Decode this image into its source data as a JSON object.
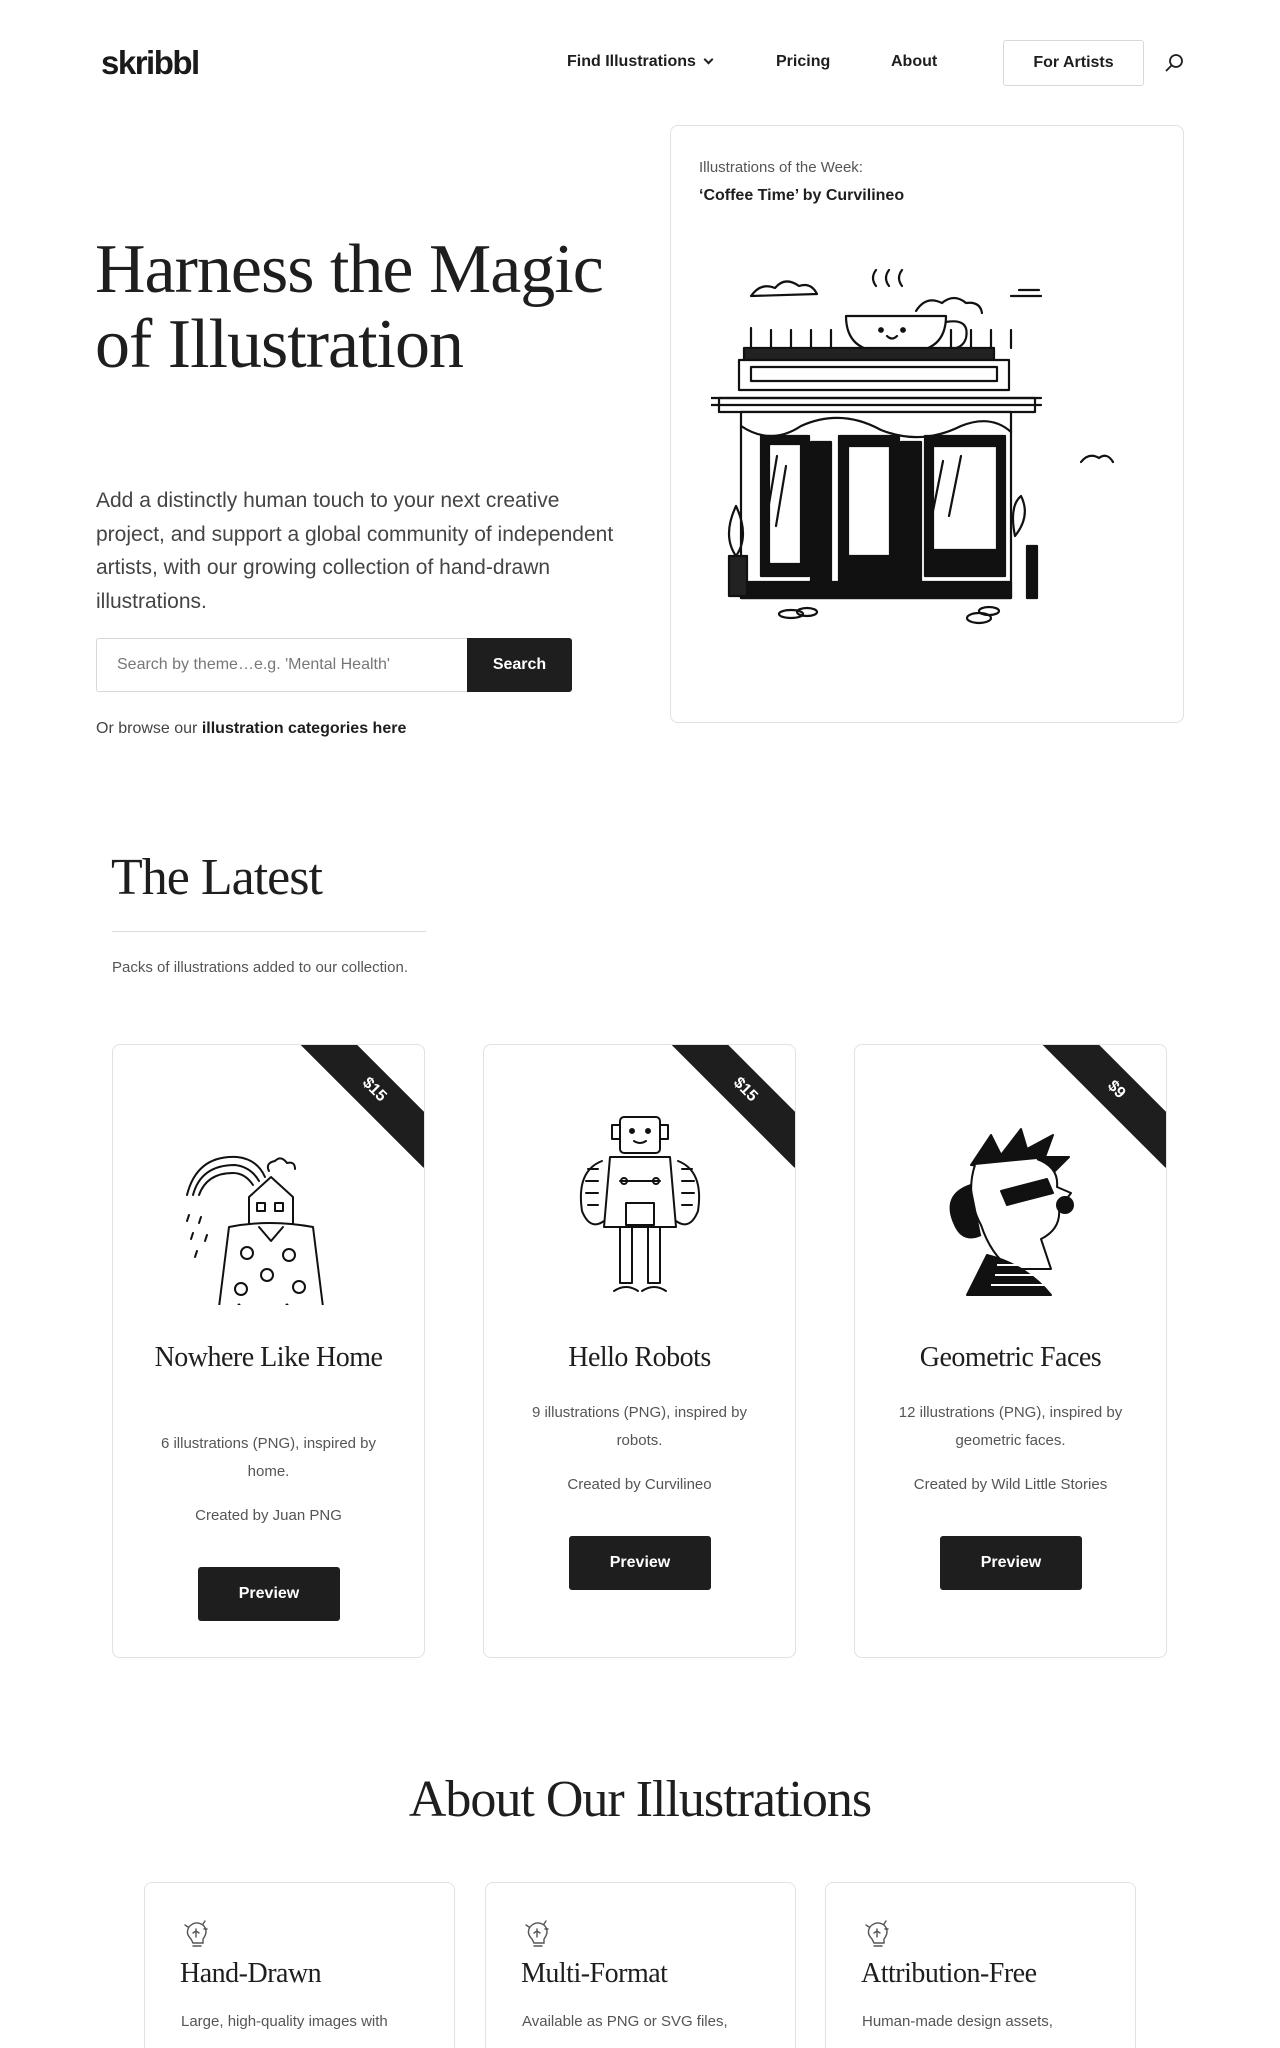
{
  "header": {
    "logo": "skribbl",
    "nav": {
      "find": "Find Illustrations",
      "pricing": "Pricing",
      "about": "About"
    },
    "for_artists": "For Artists",
    "icons": {
      "search": "search-icon",
      "dropdown": "chevron-down-icon"
    }
  },
  "hero": {
    "title": "Harness the Magic of Illustration",
    "subtitle": "Add a distinctly human touch to your next creative project, and support a global community of independent artists, with our growing collection of hand-drawn illustrations.",
    "search_placeholder": "Search by theme…e.g. 'Mental Health'",
    "search_button": "Search",
    "browse_prefix": "Or browse our",
    "browse_link": "illustration categories here"
  },
  "week": {
    "label": "Illustrations of the Week:",
    "title": "‘Coffee Time’ by Curvilineo"
  },
  "latest": {
    "title": "The Latest",
    "description": "Packs of illustrations added to our collection.",
    "packs": [
      {
        "price": "$15",
        "name": "Nowhere Like Home",
        "description": "6 illustrations (PNG), inspired by home.",
        "author": "Created by Juan PNG",
        "button": "Preview"
      },
      {
        "price": "$15",
        "name": "Hello Robots",
        "description": "9 illustrations (PNG), inspired by robots.",
        "author": "Created by Curvilineo",
        "button": "Preview"
      },
      {
        "price": "$9",
        "name": "Geometric Faces",
        "description": "12 illustrations (PNG), inspired by geometric faces.",
        "author": "Created by Wild Little Stories",
        "button": "Preview"
      }
    ]
  },
  "about": {
    "title": "About Our Illustrations",
    "features": [
      {
        "icon": "lightbulb-icon",
        "title": "Hand-Drawn",
        "description": "Large, high-quality images with"
      },
      {
        "icon": "lightbulb-icon",
        "title": "Multi-Format",
        "description": "Available as PNG or SVG files,"
      },
      {
        "icon": "lightbulb-icon",
        "title": "Attribution-Free",
        "description": "Human-made design assets,"
      }
    ]
  },
  "colors": {
    "text": "#1e1e1e",
    "muted": "#555555",
    "border": "#e2e2e2",
    "button": "#1e1e1e"
  }
}
